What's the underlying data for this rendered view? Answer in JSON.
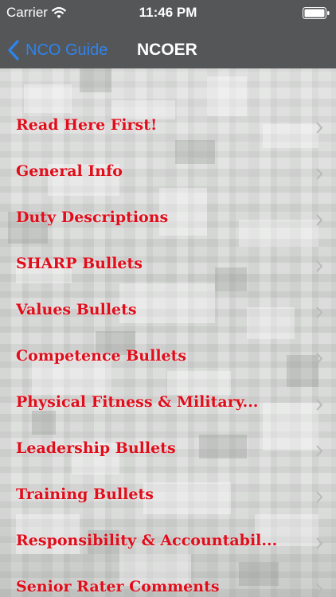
{
  "status_bar": {
    "carrier": "Carrier",
    "time": "11:46 PM",
    "wifi_icon": "wifi-icon",
    "battery_icon": "battery-icon"
  },
  "nav": {
    "back_label": "NCO Guide",
    "title": "NCOER",
    "back_color": "#2e84ee"
  },
  "list": {
    "text_color": "#e10d1b",
    "items": [
      {
        "label": "Read Here First!"
      },
      {
        "label": "General Info"
      },
      {
        "label": "Duty Descriptions"
      },
      {
        "label": "SHARP Bullets"
      },
      {
        "label": "Values Bullets"
      },
      {
        "label": "Competence Bullets"
      },
      {
        "label": "Physical Fitness & Military..."
      },
      {
        "label": "Leadership Bullets"
      },
      {
        "label": "Training Bullets"
      },
      {
        "label": "Responsibility & Accountabil..."
      },
      {
        "label": "Senior Rater Comments"
      }
    ]
  }
}
